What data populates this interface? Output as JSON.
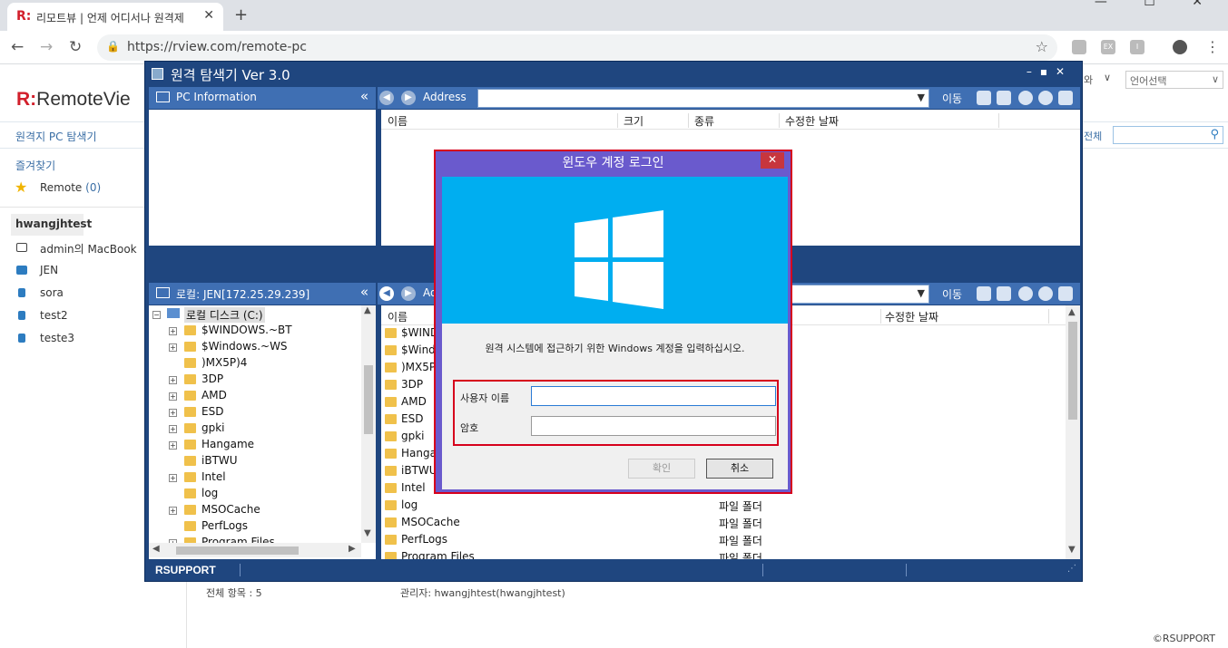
{
  "browser": {
    "tab_title": "리모트뷰 | 언제 어디서나 원격제",
    "tab_close": "✕",
    "new_tab": "+",
    "url": "https://rview.com/remote-pc",
    "window_controls": "— ☐ ✕",
    "ext_icons": [
      "EX",
      "I"
    ]
  },
  "page": {
    "logo_text": "RemoteVie",
    "subnav": "원격지 PC 탐색기",
    "favorites_label": "즐겨찾기",
    "remote_label": "Remote",
    "remote_count": "(0)",
    "group_name": "hwangjhtest",
    "devices": [
      "admin의 MacBook",
      "JEN",
      "sora",
      "test2",
      "teste3"
    ],
    "right_partial": "와",
    "language_select": "언어선택",
    "search_scope": "전체",
    "total_items": "전체 항목 : 5",
    "admin": "관리자: hwangjhtest(hwangjhtest)",
    "copyright": "©RSUPPORT"
  },
  "explorer": {
    "title": "원격 탐색기 Ver 3.0",
    "pc_info_label": "PC Information",
    "address_label": "Address",
    "move_label": "이동",
    "top_columns": [
      "이름",
      "크기",
      "종류",
      "수정한 날짜"
    ],
    "local_label": "로컬: JEN[172.25.29.239]",
    "address_label_2": "Ad",
    "bottom_columns": [
      "이름",
      "수정한 날짜"
    ],
    "drive_label": "로컬 디스크 (C:)",
    "tree": [
      {
        "name": "$WINDOWS.~BT",
        "expandable": true
      },
      {
        "name": "$Windows.~WS",
        "expandable": true
      },
      {
        "name": ")MX5P)4",
        "expandable": false
      },
      {
        "name": "3DP",
        "expandable": true
      },
      {
        "name": "AMD",
        "expandable": true
      },
      {
        "name": "ESD",
        "expandable": true
      },
      {
        "name": "gpki",
        "expandable": true
      },
      {
        "name": "Hangame",
        "expandable": true
      },
      {
        "name": "iBTWU",
        "expandable": false
      },
      {
        "name": "Intel",
        "expandable": true
      },
      {
        "name": "log",
        "expandable": false
      },
      {
        "name": "MSOCache",
        "expandable": true
      },
      {
        "name": "PerfLogs",
        "expandable": false
      },
      {
        "name": "Program Files",
        "expandable": true
      }
    ],
    "files": [
      {
        "name": "$WIND",
        "kind": ""
      },
      {
        "name": "$Wind",
        "kind": ""
      },
      {
        "name": ")MX5P",
        "kind": ""
      },
      {
        "name": "3DP",
        "kind": ""
      },
      {
        "name": "AMD",
        "kind": ""
      },
      {
        "name": "ESD",
        "kind": ""
      },
      {
        "name": "gpki",
        "kind": ""
      },
      {
        "name": "Hanga",
        "kind": ""
      },
      {
        "name": "iBTWU",
        "kind": ""
      },
      {
        "name": "Intel",
        "kind": ""
      },
      {
        "name": "log",
        "kind": "파일 폴더"
      },
      {
        "name": "MSOCache",
        "kind": "파일 폴더"
      },
      {
        "name": "PerfLogs",
        "kind": "파일 폴더"
      },
      {
        "name": "Program Files",
        "kind": "파일 폴더"
      }
    ],
    "status_brand": "RSUPPORT"
  },
  "dialog": {
    "title": "윈도우 계정 로그인",
    "close": "✕",
    "message": "원격 시스템에 접근하기 위한 Windows 계정을 입력하십시오.",
    "username_label": "사용자 이름",
    "password_label": "암호",
    "username_value": "",
    "password_value": "",
    "ok_label": "확인",
    "cancel_label": "취소"
  }
}
